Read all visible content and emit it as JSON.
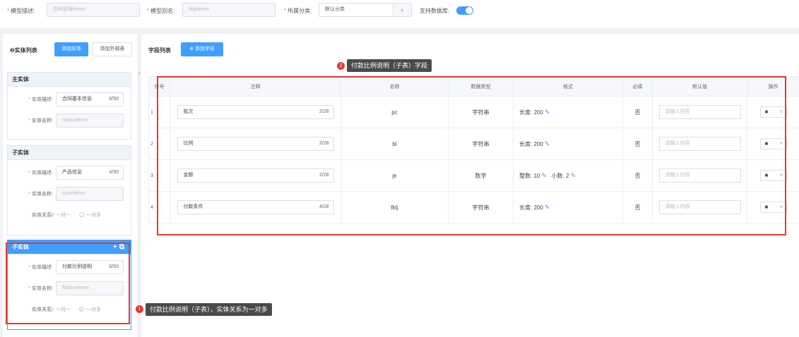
{
  "topbar": {
    "model_desc_label": "模型描述:",
    "model_desc_value": "合同管理demo",
    "model_alias_label": "模型别名:",
    "model_alias_value": "htgldemo",
    "category_label": "所属分类:",
    "category_value": "默认分类",
    "db_support_label": "支持数据库:",
    "db_support_on": true
  },
  "left_panel": {
    "title": "❷实体列表",
    "add_entity_label": "添加实体",
    "add_external_label": "添加外部表",
    "main_entity": {
      "header": "主实体",
      "desc_label": "实体描述:",
      "desc_value": "合同基本信息",
      "desc_count": "6/50",
      "name_label": "实体名称:",
      "name_value": "htjbxxdemo"
    },
    "sub_entity_1": {
      "header": "子实体",
      "desc_label": "实体描述:",
      "desc_value": "产品信息",
      "desc_count": "4/50",
      "name_label": "实体名称:",
      "name_value": "cpxxdemo",
      "relation_label": "实体关系:",
      "relation_one": "一对一",
      "relation_many": "一对多"
    },
    "sub_entity_2": {
      "header": "子实体",
      "desc_label": "实体描述:",
      "desc_value": "付款比例说明",
      "desc_count": "6/50",
      "name_label": "实体名称:",
      "name_value": "fkblsmdemo",
      "relation_label": "实体关系:",
      "relation_one": "一对一",
      "relation_many": "一对多"
    }
  },
  "right_panel": {
    "title": "字段列表",
    "add_field_label": "添加字段",
    "columns": [
      "序号",
      "注释",
      "名称",
      "数据类型",
      "格式",
      "必填",
      "默认值",
      "操作"
    ],
    "rows": [
      {
        "idx": "1",
        "comment": "批次",
        "count": "2/28",
        "name": "pc",
        "type": "字符串",
        "format": "长度: 200",
        "required": "否",
        "placeholder": "请输入内容"
      },
      {
        "idx": "2",
        "comment": "比例",
        "count": "2/28",
        "name": "bl",
        "type": "字符串",
        "format": "长度: 200",
        "required": "否",
        "placeholder": "请输入内容"
      },
      {
        "idx": "3",
        "comment": "金额",
        "count": "2/28",
        "name": "je",
        "type": "数字",
        "format": "整数: 10",
        "format2": "小数: 2",
        "required": "否",
        "placeholder": "请输入内容"
      },
      {
        "idx": "4",
        "comment": "付款条件",
        "count": "4/28",
        "name": "fktj",
        "type": "字符串",
        "format": "长度: 200",
        "required": "否",
        "placeholder": "请输入内容"
      }
    ]
  },
  "annotations": {
    "badge_1": "1",
    "callout_1": "付款比例说明（子表），实体关系为一对多",
    "badge_2": "2",
    "callout_2": "付款比例说明（子表）字段"
  },
  "colors": {
    "primary": "#409eff",
    "annotation_red": "#e53935",
    "callout_bg": "#4a4a4a"
  }
}
